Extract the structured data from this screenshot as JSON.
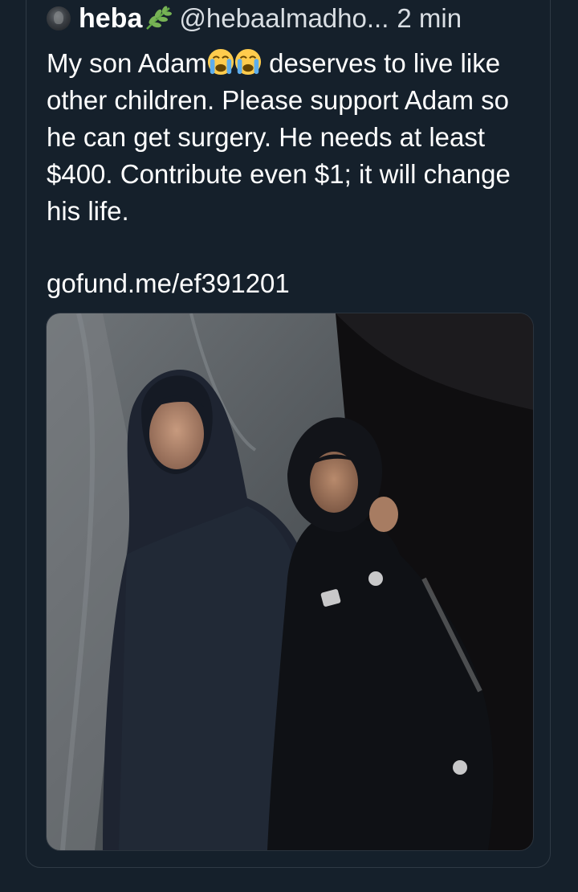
{
  "post": {
    "author": {
      "display_name": "heba",
      "badge_icon": "leaf-emoji-icon",
      "handle": "@hebaalmadho...",
      "avatar_icon": "avatar"
    },
    "timestamp": "2 min",
    "text_segments": {
      "before_emoji": "My son Adam",
      "emoji_icons": [
        "loudly-crying-face-icon",
        "loudly-crying-face-icon"
      ],
      "after_emoji": " deserves to live like other children. Please support Adam so he can get surgery. He needs at least $400. Contribute even $1; it will change his life."
    },
    "link": "gofund.me/ef391201",
    "media": {
      "type": "photo",
      "subject_icon": "photo-of-woman-and-boy"
    }
  },
  "colors": {
    "background": "#15202b",
    "text": "#ffffff",
    "muted": "#d9dee3",
    "border": "#2f3a45"
  }
}
